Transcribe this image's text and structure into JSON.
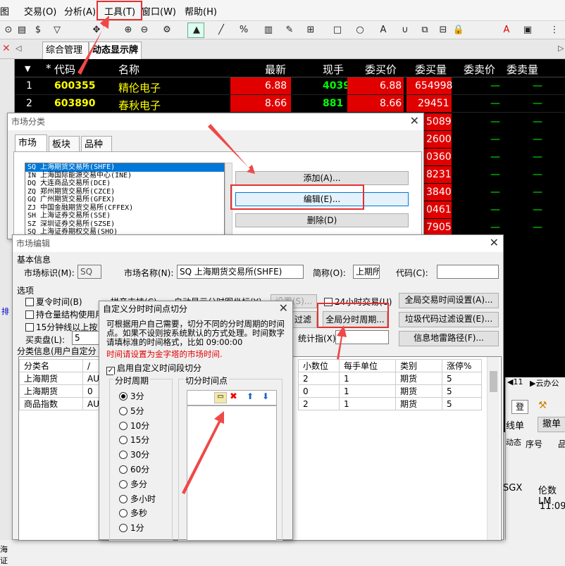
{
  "menubar": {
    "items": [
      "图",
      "交易(O)",
      "分析(A)",
      "工具(T)",
      "窗口(W)",
      "帮助(H)"
    ]
  },
  "toolbar": {
    "icons": [
      "play-icon",
      "doc-icon",
      "dollar-icon",
      "filter-icon",
      "move-icon",
      "zoom-in-icon",
      "zoom-out-icon",
      "gear-icon",
      "cursor-icon",
      "line-icon",
      "percent-icon",
      "ruler-icon",
      "pen-icon",
      "grid-icon",
      "rect-icon",
      "circle-icon",
      "text-icon",
      "magnet-icon",
      "copy-icon",
      "delete-icon",
      "lock-icon",
      "color-icon",
      "save-icon",
      "more-icon"
    ],
    "glyphs": [
      "⊙",
      "▤",
      "$",
      "▽",
      "✥",
      "⊕",
      "⊖",
      "⚙",
      "▲",
      "╱",
      "%",
      "▥",
      "✎",
      "⊞",
      "□",
      "○",
      "A",
      "∪",
      "⧉",
      "⊟",
      "🔒",
      "A",
      "▣",
      "⋮"
    ]
  },
  "tabs": {
    "t1": "综合管理",
    "t2": "动态显示牌"
  },
  "quote": {
    "headers": [
      "*",
      "代码",
      "名称",
      "最新",
      "现手",
      "委买价",
      "委买量",
      "委卖价",
      "委卖量"
    ],
    "rows": [
      {
        "no": "1",
        "code": "600355",
        "name": "精伦电子",
        "last": "6.88",
        "hand": "4039",
        "bid": "6.88",
        "bidvol": "654998",
        "ask": "—",
        "askvol": "—"
      },
      {
        "no": "2",
        "code": "603890",
        "name": "春秋电子",
        "last": "8.66",
        "hand": "881",
        "bid": "8.66",
        "bidvol": "29451",
        "ask": "—",
        "askvol": "—"
      }
    ],
    "partial_bidvols": [
      "5089",
      "2600",
      "0360",
      "8231",
      "3840",
      "0461",
      "7905"
    ],
    "sort_icon": "▼"
  },
  "market_dialog": {
    "title": "市场分类",
    "tabs": [
      "市场",
      "板块",
      "品种"
    ],
    "list": [
      "SQ 上海期货交易所(SHFE)",
      "IN 上海国际能源交易中心(INE)",
      "DQ 大连商品交易所(DCE)",
      "ZQ 郑州期货交易所(CZCE)",
      "GQ 广州期货交易所(GFEX)",
      "ZJ 中国金融期货交易所(CFFEX)",
      "SH 上海证券交易所(SSE)",
      "SZ 深圳证券交易所(SZSE)",
      "SQ 上海证券期权交易(SHO)"
    ],
    "buttons": {
      "add": "添加(A)...",
      "edit": "编辑(E)...",
      "delete": "删除(D)"
    }
  },
  "edit_dialog": {
    "title": "市场编辑",
    "basic_label": "基本信息",
    "market_id_label": "市场标识(M):",
    "market_id": "SQ",
    "market_name_label": "市场名称(N):",
    "market_name": "SQ 上海期货交易所(SHFE)",
    "short_label": "简称(O):",
    "short": "上期所",
    "code_label": "代码(C):",
    "code": "",
    "options_label": "选项",
    "opt_summer": "夏令时间(B)",
    "opt_pinyin": "拼音支持(C)",
    "opt_auto": "自动显示分时图坐标(Y)",
    "opt_set": "设置(S)...",
    "opt_24h": "24小时交易(U)",
    "opt_hold": "持仓量结构使用用",
    "opt_15": "15分钟线以上按",
    "filter_btn": "过滤",
    "buy_label": "买卖盘(L):",
    "buy_value": "5",
    "stat_label": "统计指(X):",
    "btn_global_time": "全局交易时间设置(A)...",
    "btn_global_period": "全局分时周期...",
    "btn_junk": "垃圾代码过滤设置(E)...",
    "btn_mine": "信息地雷路径(F)...",
    "class_label": "分类信息(用户自定分",
    "class_cols": [
      "分类名",
      "小数位",
      "每手单位",
      "类别",
      "涨停%"
    ],
    "class_rows": [
      {
        "name": "上海期货",
        "code": "AU",
        "dec": "2",
        "unit": "1",
        "type": "期货",
        "limit": "5"
      },
      {
        "name": "上海期货",
        "code": "0",
        "dec": "0",
        "unit": "1",
        "type": "期货",
        "limit": "5"
      },
      {
        "name": "商品指数",
        "code": "AU",
        "dec": "2",
        "unit": "1",
        "type": "期货",
        "limit": "5"
      }
    ]
  },
  "custom_dialog": {
    "title": "自定义分时时间点切分",
    "desc": "可根据用户自己需要，切分不同的分时周期的时间点。如果不设则按系统默认的方式处理。时间数字请填标准的时间格式，比如 09:00:00",
    "warn": "时间请设置为金字塔的市场时间.",
    "enable": "启用自定义时间段切分",
    "period_label": "分时周期",
    "points_label": "切分时间点",
    "periods": [
      "3分",
      "5分",
      "10分",
      "15分",
      "30分",
      "60分",
      "多分",
      "多小时",
      "多秒",
      "1分"
    ],
    "selected": "3分"
  },
  "right_panel": {
    "tab11": "◀11",
    "tab_yun": "▶云办公",
    "btn_xiandan": "线单",
    "btn_chedan": "撤单",
    "lbl_dong": "动态",
    "lbl_xuhao": "序号",
    "lbl_pin": "品",
    "lbl_sgx": "SGX",
    "lbl_lunshu": "伦数LM",
    "lbl_time": "11:09"
  },
  "left_labels": {
    "pai": "排",
    "hai": "海证"
  }
}
